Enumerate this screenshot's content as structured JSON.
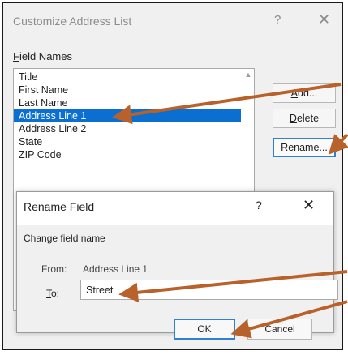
{
  "outer_dialog": {
    "title": "Customize Address List",
    "help": "?",
    "close": "✕",
    "field_names_label_first": "F",
    "field_names_label_rest": "ield Names",
    "fields": [
      "Title",
      "First Name",
      "Last Name",
      "Address Line 1",
      "Address Line 2",
      "State",
      "ZIP Code"
    ],
    "selected_field": "Address Line 1",
    "buttons": {
      "add_first": "A",
      "add_rest": "dd...",
      "delete_first": "D",
      "delete_rest": "elete",
      "rename_first": "R",
      "rename_rest": "ename..."
    }
  },
  "rename_dialog": {
    "title": "Rename Field",
    "help": "?",
    "close": "✕",
    "change_label": "Change field name",
    "from_label": "From:",
    "from_value": "Address Line 1",
    "to_label_first": "T",
    "to_label_rest": "o:",
    "to_value": "Street",
    "ok_label": "OK",
    "cancel_label": "Cancel"
  },
  "colors": {
    "selection": "#0a6fd0",
    "arrow": "#b8612a",
    "focus_border": "#2f7fd6"
  }
}
